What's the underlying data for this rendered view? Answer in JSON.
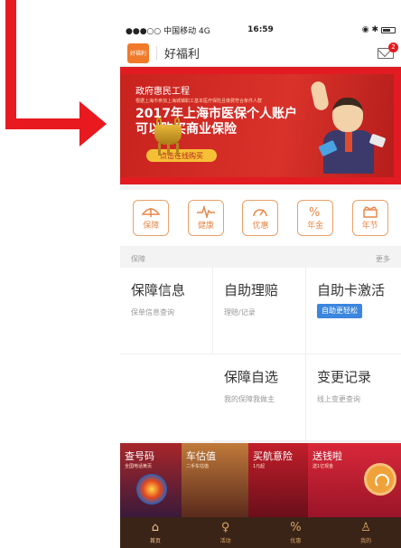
{
  "status_bar": {
    "carrier": "●●●○○ 中国移动 4G",
    "time": "16:59",
    "icons": "◉ ✱"
  },
  "app_bar": {
    "logo_text": "好福利",
    "title": "好福利",
    "mail_badge": "2"
  },
  "banner": {
    "subject": "政府惠民工程",
    "fine_print": "根据上海市参加上海城镇职工基本医疗保险且缴费符合条件人群",
    "headline": "2017年上海市医保个人账户可以购买商业保险",
    "cta": "点击在线购买"
  },
  "categories": [
    {
      "label": "保障",
      "icon": "umbrella-icon"
    },
    {
      "label": "健康",
      "icon": "heartbeat-icon"
    },
    {
      "label": "优惠",
      "icon": "discount-icon"
    },
    {
      "label": "年金",
      "icon": "percent-icon"
    },
    {
      "label": "年节",
      "icon": "gift-icon"
    }
  ],
  "section": {
    "title": "保障",
    "more": "更多"
  },
  "grid": {
    "policy_info": {
      "title": "保障信息",
      "subtitle": "保单信息查询"
    },
    "self_claim": {
      "title": "自助理赔",
      "subtitle": "理赔/记录"
    },
    "card_activation": {
      "title": "自助卡激活",
      "button": "自助更轻松"
    },
    "self_select": {
      "title": "保障自选",
      "subtitle": "我的保障我做主"
    },
    "change_record": {
      "title": "变更记录",
      "subtitle": "线上变更查询"
    }
  },
  "promos": [
    {
      "title": "查号码",
      "subtitle": "全国电话黄页"
    },
    {
      "title": "车估值",
      "subtitle": "二手车估值"
    },
    {
      "title": "买航意险",
      "subtitle": "1元起"
    },
    {
      "title": "送钱啦",
      "subtitle": "送1亿现金"
    }
  ],
  "tabs": [
    {
      "label": "首页",
      "icon": "home-icon",
      "glyph": "⌂"
    },
    {
      "label": "活动",
      "icon": "activity-icon",
      "glyph": "♀"
    },
    {
      "label": "优惠",
      "icon": "discount-icon",
      "glyph": "%"
    },
    {
      "label": "我的",
      "icon": "user-icon",
      "glyph": "♙"
    }
  ],
  "colors": {
    "accent": "#e7894a",
    "highlight": "#e21b22",
    "tabbar": "#3a2418",
    "button_blue": "#3b86de"
  }
}
